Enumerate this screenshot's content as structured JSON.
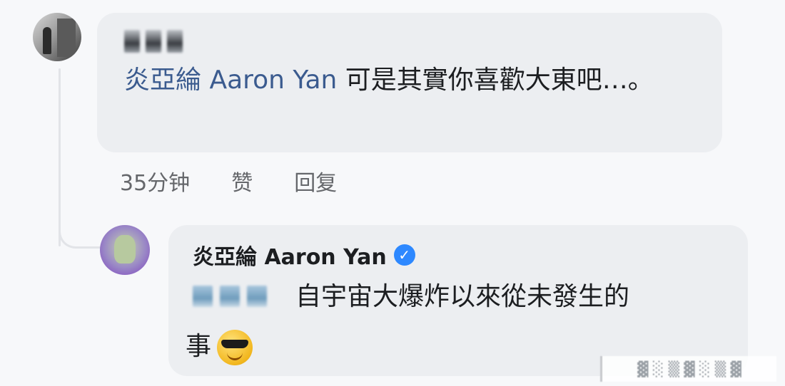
{
  "comment1": {
    "author_name": "",
    "mention": "炎亞綸 Aaron Yan",
    "text": " 可是其實你喜歡大東吧…。",
    "time": "35分钟",
    "like_label": "赞",
    "reply_label": "回复"
  },
  "comment2": {
    "author_name": "炎亞綸 Aaron Yan",
    "mention": "",
    "text_line1": "自宇宙大爆炸以來從未發生的",
    "text_line2": "事",
    "emoji": "smiling-face-with-sunglasses"
  },
  "colors": {
    "mention": "#3b5b8f",
    "bubble": "#eceef1",
    "verified": "#2d88ff",
    "meta": "#65676b"
  }
}
